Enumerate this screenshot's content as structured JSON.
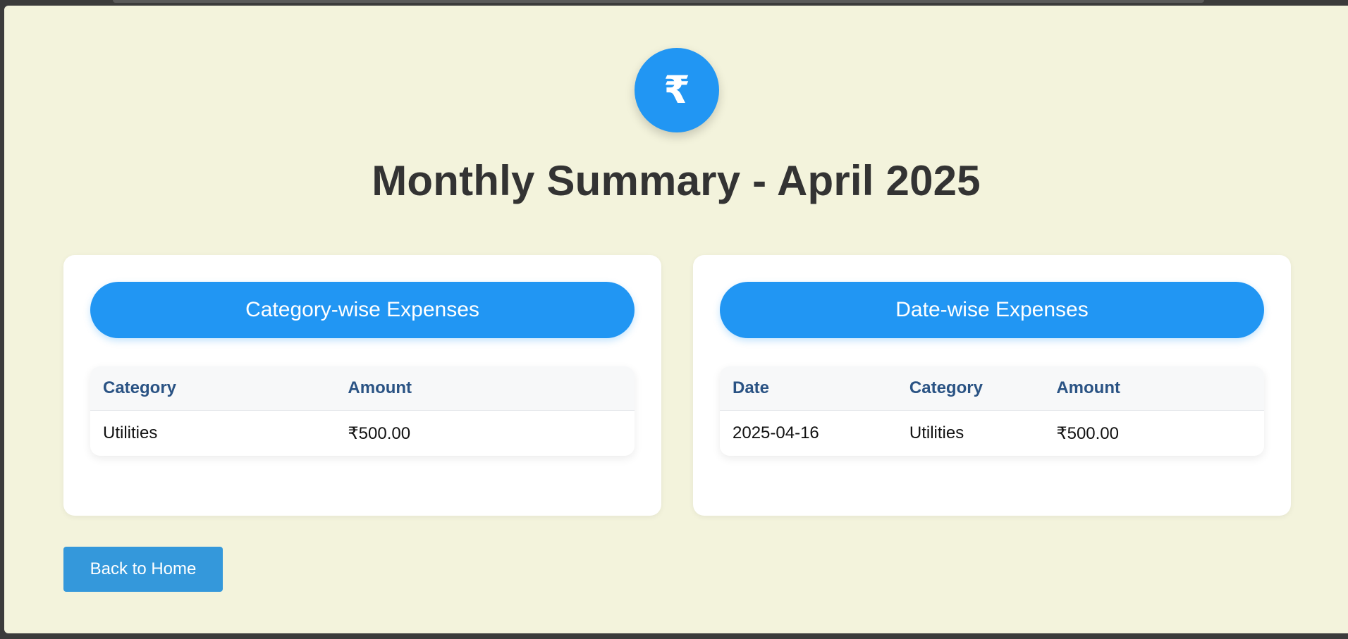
{
  "header": {
    "logo_symbol": "₹",
    "title": "Monthly Summary - April 2025"
  },
  "category_card": {
    "heading": "Category-wise Expenses",
    "columns": [
      "Category",
      "Amount"
    ],
    "rows": [
      [
        "Utilities",
        "₹500.00"
      ]
    ]
  },
  "date_card": {
    "heading": "Date-wise Expenses",
    "columns": [
      "Date",
      "Category",
      "Amount"
    ],
    "rows": [
      [
        "2025-04-16",
        "Utilities",
        "₹500.00"
      ]
    ]
  },
  "actions": {
    "back_label": "Back to Home"
  },
  "colors": {
    "accent": "#2196f3",
    "button": "#3498db",
    "page_bg": "#f3f3dc",
    "header_text": "#2a5384"
  },
  "icons": {
    "logo": "rupee-icon"
  }
}
